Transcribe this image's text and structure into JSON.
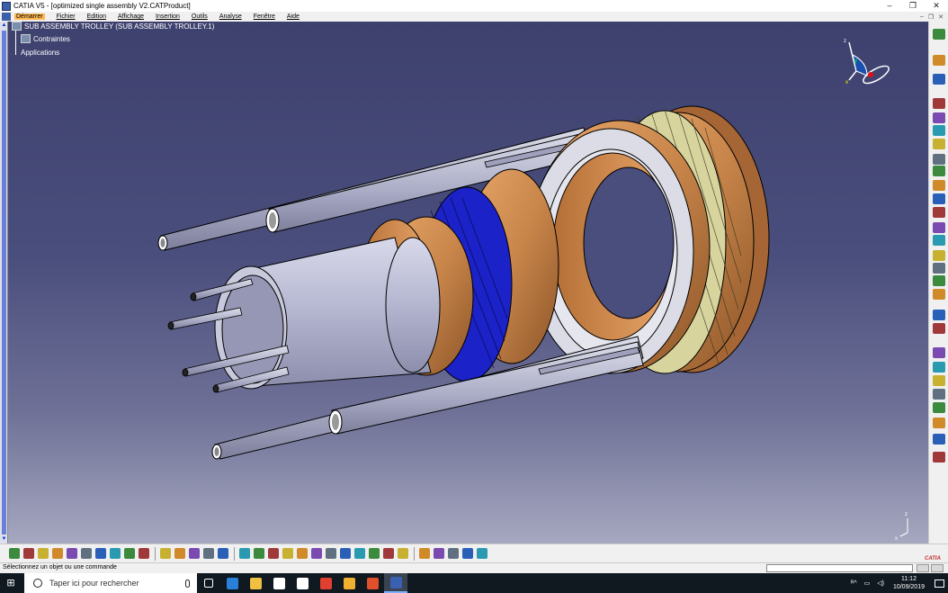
{
  "window": {
    "title": "CATIA V5 - [optimized single assembly V2.CATProduct]",
    "controls": [
      "–",
      "❐",
      "✕"
    ]
  },
  "menubar": {
    "items": [
      {
        "label": "Démarrer",
        "active": true
      },
      {
        "label": "Fichier"
      },
      {
        "label": "Edition"
      },
      {
        "label": "Affichage"
      },
      {
        "label": "Insertion"
      },
      {
        "label": "Outils"
      },
      {
        "label": "Analyse"
      },
      {
        "label": "Fenêtre"
      },
      {
        "label": "Aide"
      }
    ],
    "mdi_controls": [
      "–",
      "❐",
      "✕"
    ]
  },
  "spec_tree": {
    "root": "SUB ASSEMBLY TROLLEY (SUB ASSEMBLY TROLLEY.1)",
    "children": [
      "Contraintes",
      "Applications"
    ]
  },
  "compass": {
    "axes": [
      "x",
      "y",
      "z"
    ]
  },
  "viewport": {
    "background_top": "#3e416e",
    "background_bottom": "#a6a8c0",
    "axis_labels": [
      "z",
      "x"
    ]
  },
  "colors": {
    "bronze": "#c8854a",
    "steel": "#b4b6d0",
    "blue_bearing": "#1a22c8",
    "cream_bearing": "#d8d49e",
    "accent_orange": "#fdb851"
  },
  "toolbars": {
    "right_icons": [
      "rotate-icon",
      "cursor-icon",
      "fly-icon",
      "sketch-icon",
      "assembly-icon",
      "component-icon",
      "product-icon",
      "part-icon",
      "existing-component-icon",
      "replace-icon",
      "graph-tree-icon",
      "reorder-icon",
      "numbering-icon",
      "scenes-icon",
      "explode-icon",
      "manipulate-icon",
      "snap-icon",
      "smart-move-icon",
      "constraint-coincidence-icon",
      "constraint-contact-icon",
      "constraint-offset-icon",
      "constraint-angle-icon",
      "constraint-fix-icon",
      "update-icon",
      "measure-icon",
      "clash-icon",
      "section-icon",
      "catalog-icon"
    ],
    "bottom_icons": [
      "new-icon",
      "open-icon",
      "save-icon",
      "print-icon",
      "cut-icon",
      "copy-icon",
      "paste-icon",
      "undo-icon",
      "redo-icon",
      "whats-this-icon",
      "formula-icon",
      "comment-icon",
      "design-table-icon",
      "law-icon",
      "spec-tree-icon",
      "fit-all-icon",
      "pan-icon",
      "rotate-view-icon",
      "zoom-in-icon",
      "zoom-out-icon",
      "normal-view-icon",
      "iso-view-icon",
      "render-icon",
      "hide-show-icon",
      "swap-icon",
      "quick-select-icon",
      "material-icon",
      "properties-icon",
      "analyze-icon",
      "web-icon",
      "update-all-icon",
      "multi-view-icon"
    ]
  },
  "status": {
    "message": "Sélectionnez un objet ou une commande",
    "command_placeholder": ""
  },
  "taskbar": {
    "search_placeholder": "Taper ici pour rechercher",
    "apps": [
      "task-view-icon",
      "edge-icon",
      "file-explorer-icon",
      "store-icon",
      "mail-icon",
      "chrome-icon",
      "folder-icon",
      "office-icon",
      "catia-taskbar-icon"
    ],
    "tray_text": "ᴿ^",
    "time": "11:12",
    "date": "10/09/2019"
  }
}
